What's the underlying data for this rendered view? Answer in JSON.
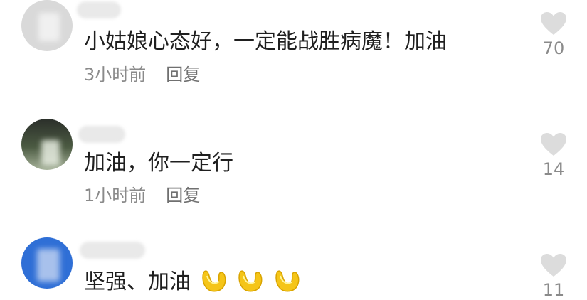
{
  "comments": [
    {
      "text": "小姑娘心态好，一定能战胜病魔！加油",
      "time": "3小时前",
      "reply_label": "回复",
      "likes": "70",
      "avatar_color": "#dcdcdc"
    },
    {
      "text": "加油，你一定行",
      "time": "1小时前",
      "reply_label": "回复",
      "likes": "14",
      "avatar_color": "#3d4a3a"
    },
    {
      "text": "坚强、加油",
      "time": "",
      "reply_label": "",
      "likes": "11",
      "avatar_color": "#2f6fd6",
      "emoji": [
        "flexed-biceps",
        "flexed-biceps",
        "flexed-biceps"
      ]
    }
  ],
  "colors": {
    "text": "#1f1f1f",
    "meta": "#8a8a8a",
    "heart": "#dcdcdc",
    "emoji": "#f5c518"
  }
}
